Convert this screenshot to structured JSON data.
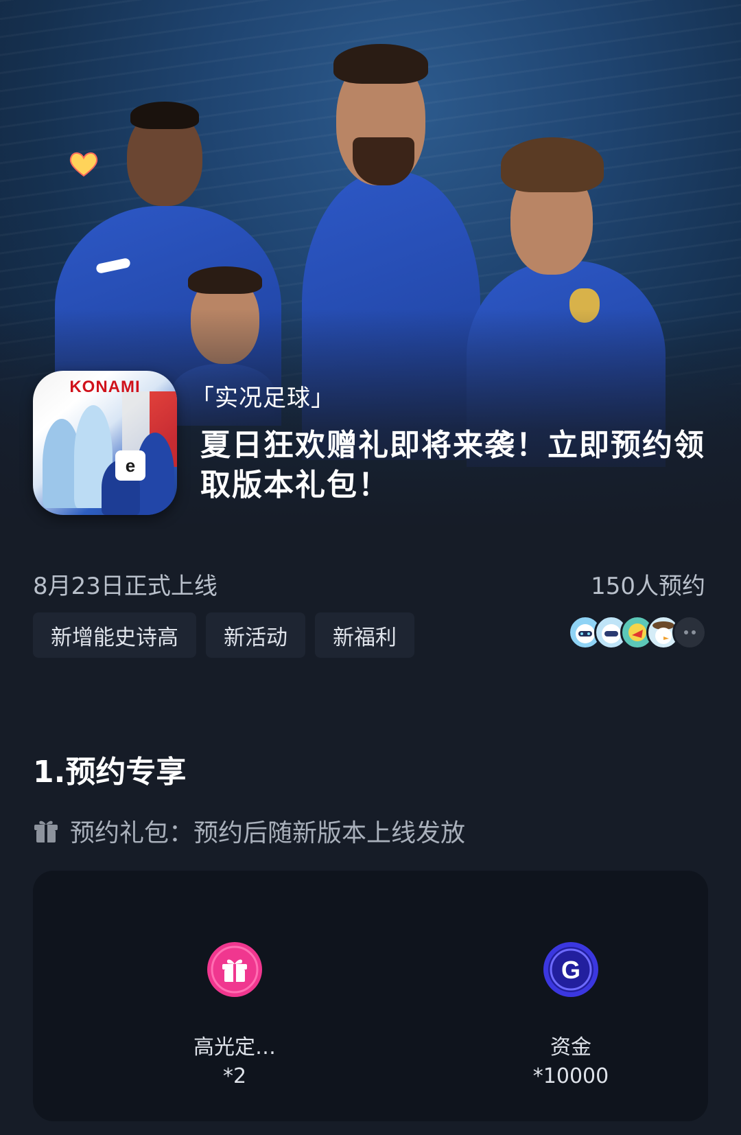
{
  "hero": {
    "tag": "「实况足球」",
    "title": "夏日狂欢赠礼即将来袭！立即预约领取版本礼包！",
    "app_icon": {
      "brand": "KONAMI",
      "logo": "e"
    }
  },
  "info": {
    "launch_date": "8月23日正式上线",
    "reservations": "150人预约",
    "tags": [
      "新增能史诗高",
      "新活动",
      "新福利"
    ]
  },
  "section": {
    "title": "1.预约专享",
    "gift_label": "预约礼包：预约后随新版本上线发放"
  },
  "rewards": [
    {
      "name": "高光定…",
      "qty": "*2",
      "icon": "gift-icon",
      "color": "#f0378f"
    },
    {
      "name": "资金",
      "qty": "*10000",
      "icon": "coin-g-icon",
      "color": "#3b37e0"
    }
  ],
  "colors": {
    "background": "#161c27",
    "card": "#0f141d",
    "tag_bg": "#1e2532"
  }
}
